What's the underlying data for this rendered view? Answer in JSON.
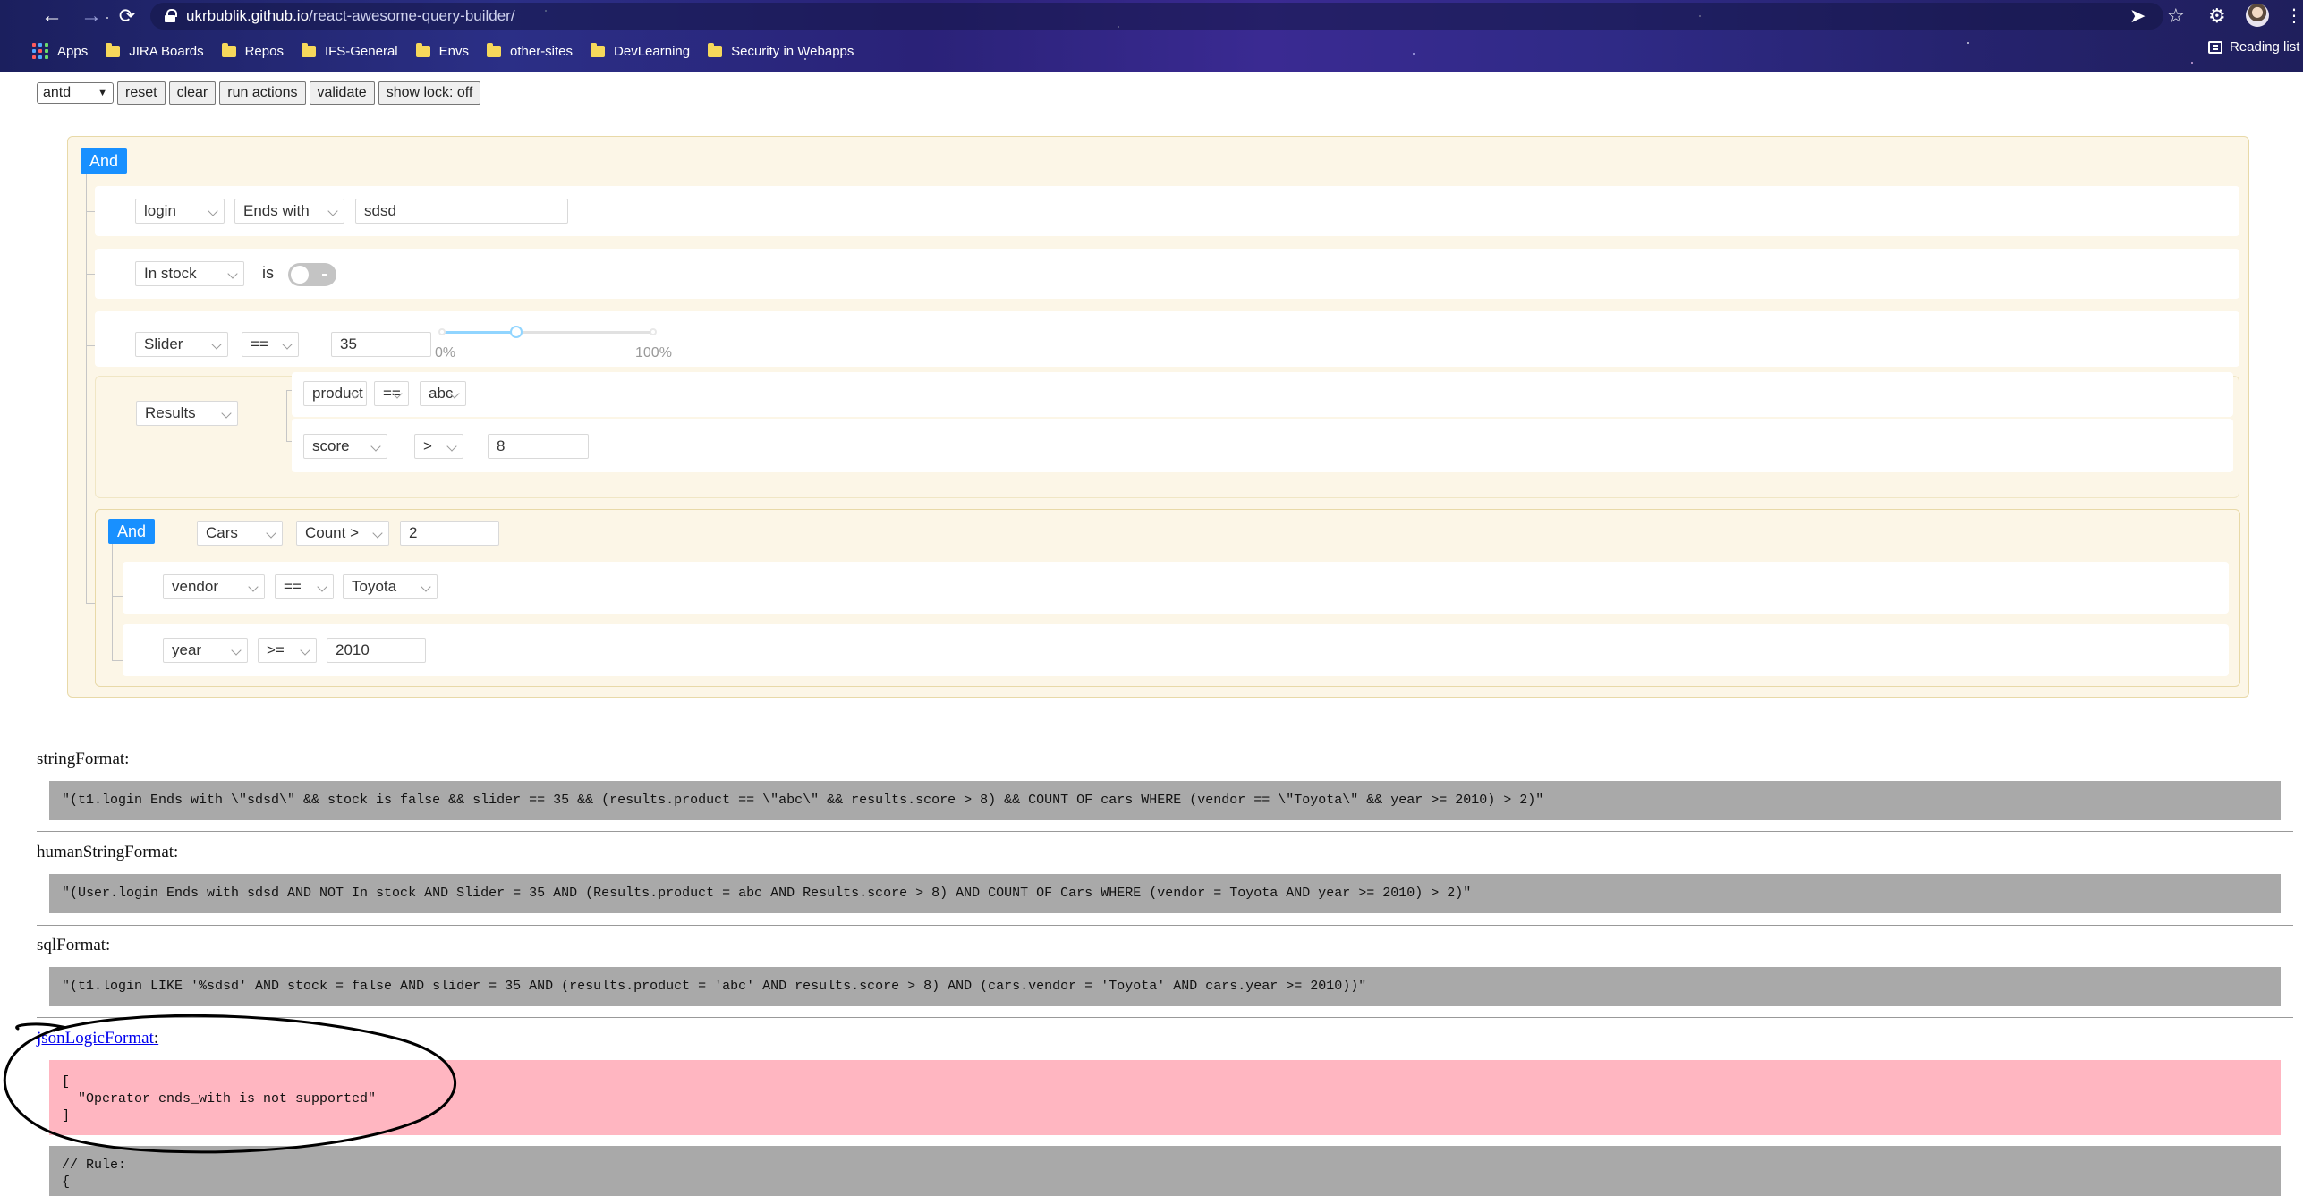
{
  "browser": {
    "url_host": "ukrbublik.github.io",
    "url_path": "/react-awesome-query-builder/",
    "bookmarks": [
      {
        "label": "Apps",
        "icon": "apps-grid-icon"
      },
      {
        "label": "JIRA Boards",
        "icon": "folder-icon"
      },
      {
        "label": "Repos",
        "icon": "folder-icon"
      },
      {
        "label": "IFS-General",
        "icon": "folder-icon"
      },
      {
        "label": "Envs",
        "icon": "folder-icon"
      },
      {
        "label": "other-sites",
        "icon": "folder-icon"
      },
      {
        "label": "DevLearning",
        "icon": "folder-icon"
      },
      {
        "label": "Security in Webapps",
        "icon": "folder-icon"
      }
    ],
    "reading_list": "Reading list"
  },
  "toolbar": {
    "theme_value": "antd",
    "reset": "reset",
    "clear": "clear",
    "run_actions": "run actions",
    "validate": "validate",
    "show_lock": "show lock: off"
  },
  "builder": {
    "root_conjunction": "And",
    "rule1": {
      "field": "login",
      "operator": "Ends with",
      "value": "sdsd"
    },
    "rule2": {
      "field": "In stock",
      "operator": "is",
      "value": false
    },
    "rule3": {
      "field": "Slider",
      "operator": "==",
      "value": "35",
      "slider_fraction": 0.35,
      "min_label": "0%",
      "max_label": "100%"
    },
    "results_group": {
      "field": "Results",
      "rules": [
        {
          "field": "product",
          "operator": "==",
          "value": "abc"
        },
        {
          "field": "score",
          "operator": ">",
          "value": "8"
        }
      ]
    },
    "cars_group": {
      "conjunction": "And",
      "field": "Cars",
      "operator": "Count >",
      "value": "2",
      "rules": [
        {
          "field": "vendor",
          "operator": "==",
          "value": "Toyota"
        },
        {
          "field": "year",
          "operator": ">=",
          "value": "2010"
        }
      ]
    }
  },
  "outputs": {
    "string_label": "stringFormat:",
    "string_value": "\"(t1.login Ends with \\\"sdsd\\\" && stock is false && slider == 35 && (results.product == \\\"abc\\\" && results.score > 8) && COUNT OF cars WHERE (vendor == \\\"Toyota\\\" && year >= 2010) > 2)\"",
    "human_label": "humanStringFormat:",
    "human_value": "\"(User.login Ends with sdsd AND NOT In stock AND Slider = 35 AND (Results.product = abc AND Results.score > 8) AND COUNT OF Cars WHERE (vendor = Toyota AND year >= 2010) > 2)\"",
    "sql_label": "sqlFormat:",
    "sql_value": "\"(t1.login LIKE '%sdsd' AND stock = false AND slider = 35 AND (results.product = 'abc' AND results.score > 8) AND (cars.vendor = 'Toyota' AND cars.year >= 2010))\"",
    "jsonlogic_link": "jsonLogicFormat",
    "jsonlogic_colon": ":",
    "jsonlogic_error": "[\n  \"Operator ends_with is not supported\"\n]",
    "rule_comment": "// Rule:\n{"
  },
  "colors": {
    "conjunction_blue": "#1890ff",
    "group_bg": "#fcf6e7",
    "code_bg": "#a9a9a9",
    "error_bg": "#ffb6c1"
  }
}
